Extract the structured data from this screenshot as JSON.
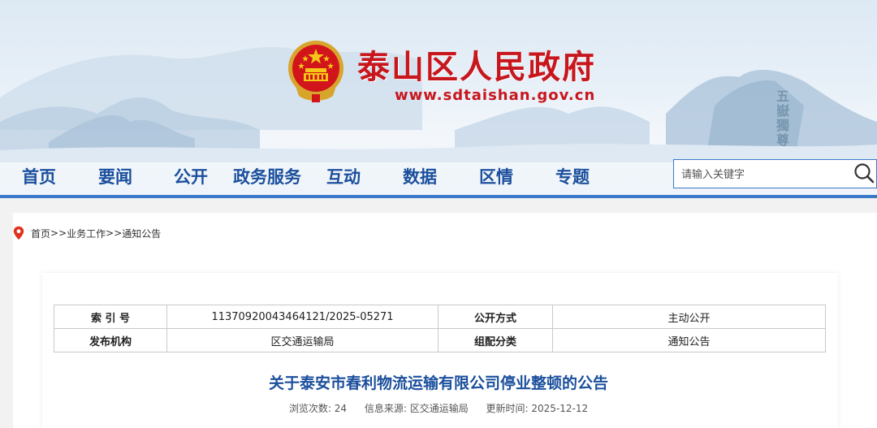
{
  "header": {
    "site_title": "泰山区人民政府",
    "site_url": "www.sdtaishan.gov.cn",
    "calligraphy": "五嶽獨尊",
    "brand_color": "#c8161d"
  },
  "nav": {
    "items": [
      "首页",
      "要闻",
      "公开",
      "政务服务",
      "互动",
      "数据",
      "区情",
      "专题"
    ],
    "accent_color": "#1b4f9c"
  },
  "search": {
    "placeholder": "请输入关键字"
  },
  "breadcrumb": {
    "items": [
      "首页",
      "业务工作",
      "通知公告"
    ],
    "separator": ">>"
  },
  "meta_table": {
    "rows": [
      {
        "label1": "索 引 号",
        "value1": "11370920043464121/2025-05271",
        "label2": "公开方式",
        "value2": "主动公开"
      },
      {
        "label1": "发布机构",
        "value1": "区交通运输局",
        "label2": "组配分类",
        "value2": "通知公告"
      }
    ]
  },
  "article": {
    "title": "关于泰安市春利物流运输有限公司停业整顿的公告",
    "views_label": "浏览次数:",
    "views": "24",
    "source_label": "信息来源:",
    "source": "区交通运输局",
    "updated_label": "更新时间:",
    "updated": "2025-12-12"
  }
}
